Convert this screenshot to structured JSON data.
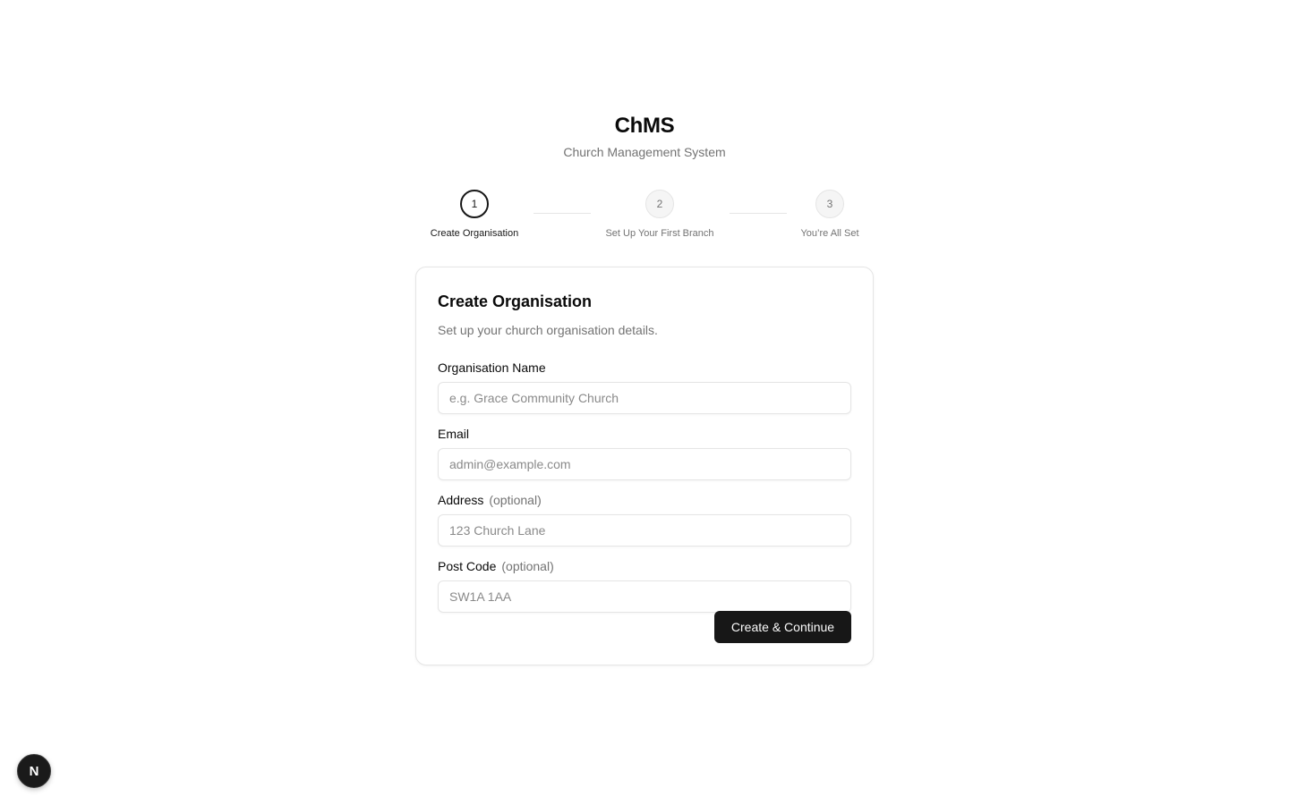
{
  "app": {
    "title": "ChMS",
    "subtitle": "Church Management System"
  },
  "stepper": {
    "current_step": 1,
    "steps": [
      {
        "number": "1",
        "label": "Create Organisation",
        "state": "active"
      },
      {
        "number": "2",
        "label": "Set Up Your First Branch",
        "state": "inactive"
      },
      {
        "number": "3",
        "label": "You’re All Set",
        "state": "inactive"
      }
    ]
  },
  "form": {
    "title": "Create Organisation",
    "description": "Set up your church organisation details.",
    "fields": {
      "org_name": {
        "label": "Organisation Name",
        "placeholder": "e.g. Grace Community Church",
        "value": ""
      },
      "email": {
        "label": "Email",
        "placeholder": "admin@example.com",
        "value": ""
      },
      "address": {
        "label": "Address",
        "optional": "(optional)",
        "placeholder": "123 Church Lane",
        "value": ""
      },
      "post_code": {
        "label": "Post Code",
        "optional": "(optional)",
        "placeholder": "SW1A 1AA",
        "value": ""
      }
    },
    "submit_label": "Create & Continue"
  },
  "dev_badge": {
    "letter": "N",
    "icon": "nextjs-icon"
  },
  "colors": {
    "primary": "#171717",
    "muted_text": "#737373",
    "border": "#e5e5e5"
  }
}
